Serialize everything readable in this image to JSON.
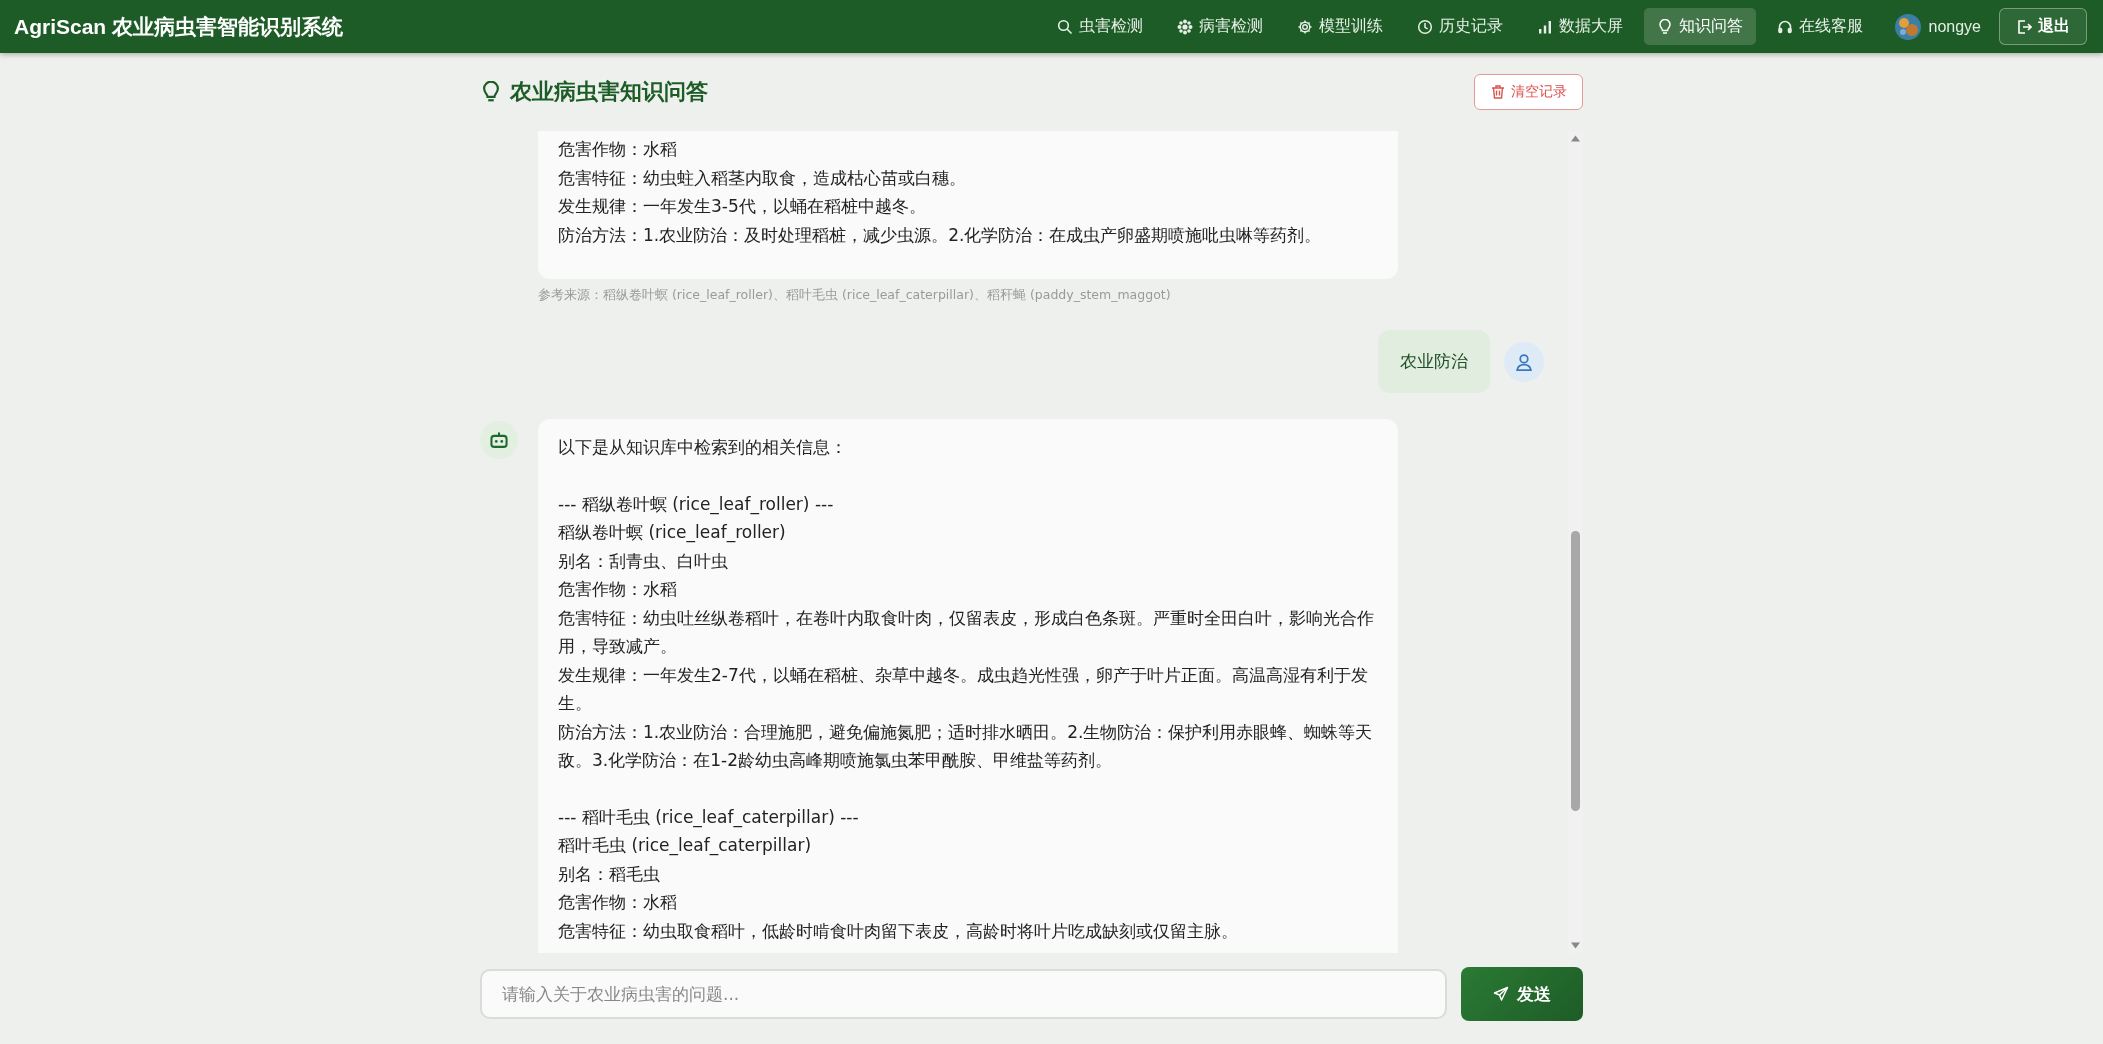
{
  "header": {
    "title": "AgriScan 农业病虫害智能识别系统",
    "nav": [
      {
        "label": "虫害检测",
        "selected": false
      },
      {
        "label": "病害检测",
        "selected": false
      },
      {
        "label": "模型训练",
        "selected": false
      },
      {
        "label": "历史记录",
        "selected": false
      },
      {
        "label": "数据大屏",
        "selected": false
      },
      {
        "label": "知识问答",
        "selected": true
      },
      {
        "label": "在线客服",
        "selected": false
      }
    ],
    "user": "nongye",
    "logout": "退出"
  },
  "page": {
    "title": "农业病虫害知识问答",
    "clear_button": "清空记录"
  },
  "messages": [
    {
      "kind": "bot",
      "sections": [
        [
          "危害作物：水稻",
          "危害特征：幼虫蛀入稻茎内取食，造成枯心苗或白穗。",
          "发生规律：一年发生3-5代，以蛹在稻桩中越冬。",
          "防治方法：1.农业防治：及时处理稻桩，减少虫源。2.化学防治：在成虫产卵盛期喷施吡虫啉等药剂。"
        ]
      ],
      "source": "参考来源：稻纵卷叶螟 (rice_leaf_roller)、稻叶毛虫 (rice_leaf_caterpillar)、稻秆蝇 (paddy_stem_maggot)",
      "cut_top": true
    },
    {
      "kind": "user",
      "sections": [
        [
          "农业防治"
        ]
      ]
    },
    {
      "kind": "bot",
      "sections": [
        [
          "以下是从知识库中检索到的相关信息："
        ],
        [
          "--- 稻纵卷叶螟 (rice_leaf_roller) ---",
          "稻纵卷叶螟 (rice_leaf_roller)",
          "别名：刮青虫、白叶虫",
          "危害作物：水稻",
          "危害特征：幼虫吐丝纵卷稻叶，在卷叶内取食叶肉，仅留表皮，形成白色条斑。严重时全田白叶，影响光合作用，导致减产。",
          "发生规律：一年发生2-7代，以蛹在稻桩、杂草中越冬。成虫趋光性强，卵产于叶片正面。高温高湿有利于发生。",
          "防治方法：1.农业防治：合理施肥，避免偏施氮肥；适时排水晒田。2.生物防治：保护利用赤眼蜂、蜘蛛等天敌。3.化学防治：在1-2龄幼虫高峰期喷施氯虫苯甲酰胺、甲维盐等药剂。"
        ],
        [
          "--- 稻叶毛虫 (rice_leaf_caterpillar) ---",
          "稻叶毛虫 (rice_leaf_caterpillar)",
          "别名：稻毛虫",
          "危害作物：水稻",
          "危害特征：幼虫取食稻叶，低龄时啃食叶肉留下表皮，高龄时将叶片吃成缺刻或仅留主脉。"
        ]
      ],
      "cut_top": false
    }
  ],
  "input": {
    "placeholder": "请输入关于农业病虫害的问题..."
  },
  "send_button": "发送"
}
